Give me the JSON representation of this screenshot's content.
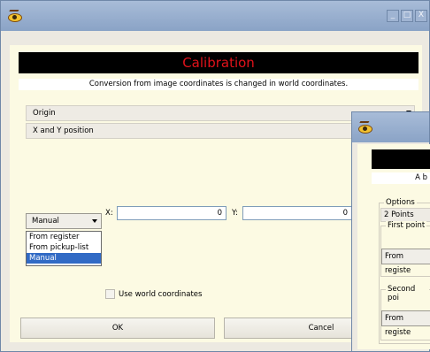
{
  "main": {
    "title_buttons": {
      "minimize": "_",
      "maximize": "□",
      "close": "X"
    },
    "header": {
      "title": "Calibration",
      "info": "Conversion from image coordinates is changed in world coordinates."
    },
    "rows": {
      "origin": "Origin",
      "position": "X and Y position"
    },
    "mode_select": {
      "value": "Manual",
      "options": [
        "From register",
        "From pickup-list",
        "Manual"
      ]
    },
    "x_label": "X:",
    "x_value": "0",
    "y_label": "Y:",
    "y_value": "0",
    "world_coords": {
      "label": "Use world coordinates",
      "checked": false
    },
    "ok_label": "OK",
    "cancel_label": "Cancel"
  },
  "second": {
    "info_fragment": "A b",
    "options_label": "Options",
    "points_value": "2 Points",
    "first_point_label": "First point",
    "first_select": "From registe",
    "second_point_label": "Second poi",
    "second_select": "From registe"
  },
  "colors": {
    "banner_bg": "#000000",
    "banner_text": "#e0121a",
    "panel_bg": "#fcfae3",
    "selected": "#316ac5"
  }
}
